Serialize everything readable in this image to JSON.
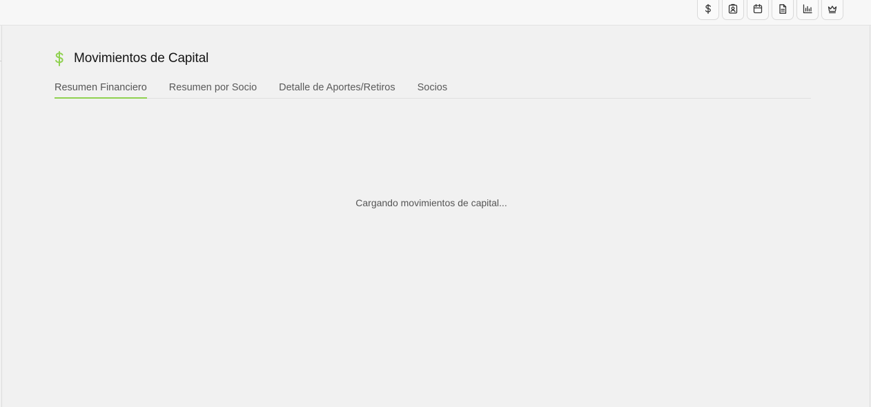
{
  "toolbar": {
    "buttons": [
      {
        "icon": "dollar-icon"
      },
      {
        "icon": "contact-badge-icon"
      },
      {
        "icon": "calendar-icon"
      },
      {
        "icon": "document-icon"
      },
      {
        "icon": "bar-chart-icon"
      },
      {
        "icon": "crown-icon"
      }
    ]
  },
  "header": {
    "icon": "dollar-icon",
    "icon_color": "#8fd14f",
    "title": "Movimientos de Capital"
  },
  "tabs": [
    {
      "label": "Resumen Financiero",
      "active": true
    },
    {
      "label": "Resumen por Socio",
      "active": false
    },
    {
      "label": "Detalle de Aportes/Retiros",
      "active": false
    },
    {
      "label": "Socios",
      "active": false
    }
  ],
  "main": {
    "loading_text": "Cargando movimientos de capital..."
  }
}
